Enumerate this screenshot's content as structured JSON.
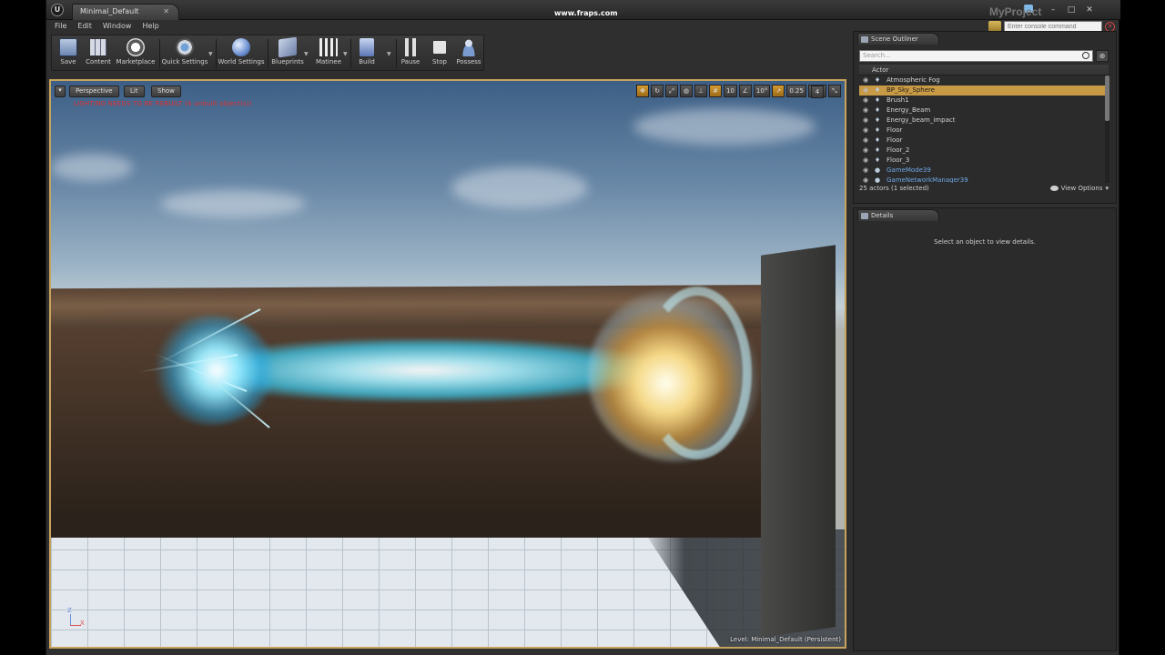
{
  "window": {
    "tab_title": "Minimal_Default",
    "overlay_text": "www.fraps.com",
    "project_name": "MyProject",
    "minimize": "–",
    "maximize": "□",
    "close": "✕"
  },
  "menu": [
    "File",
    "Edit",
    "Window",
    "Help"
  ],
  "console": {
    "placeholder": "Enter console command"
  },
  "toolbar": {
    "items": [
      {
        "label": "Save",
        "icon": "save-icon"
      },
      {
        "label": "Content",
        "icon": "content-browser-icon"
      },
      {
        "label": "Marketplace",
        "icon": "marketplace-icon"
      },
      {
        "label": "Quick Settings",
        "icon": "quick-settings-icon"
      },
      {
        "label": "World Settings",
        "icon": "world-settings-icon"
      },
      {
        "label": "Blueprints",
        "icon": "blueprints-icon"
      },
      {
        "label": "Matinee",
        "icon": "matinee-icon"
      },
      {
        "label": "Build",
        "icon": "build-icon"
      },
      {
        "label": "Pause",
        "icon": "pause-icon"
      },
      {
        "label": "Stop",
        "icon": "stop-icon"
      },
      {
        "label": "Possess",
        "icon": "possess-icon"
      }
    ]
  },
  "viewport": {
    "perspective": "Perspective",
    "lit": "Lit",
    "show": "Show",
    "warning": "LIGHTING NEEDS TO BE REBUILT (4 unbuilt object(s))",
    "grid_snap": "10",
    "rot_snap": "10°",
    "scale_snap": "0.25",
    "cam_speed": "4",
    "level_label": "Level:",
    "level_name": "Minimal_Default (Persistent)",
    "axis_z": "Z",
    "axis_x": "X"
  },
  "outliner": {
    "tab": "Scene Outliner",
    "search_placeholder": "Search...",
    "column": "Actor",
    "rows": [
      {
        "label": "Atmospheric Fog",
        "link": false
      },
      {
        "label": "BP_Sky_Sphere",
        "link": false,
        "selected": true
      },
      {
        "label": "Brush1",
        "link": false
      },
      {
        "label": "Energy_Beam",
        "link": false
      },
      {
        "label": "Energy_beam_impact",
        "link": false
      },
      {
        "label": "Floor",
        "link": false
      },
      {
        "label": "Floor",
        "link": false
      },
      {
        "label": "Floor_2",
        "link": false
      },
      {
        "label": "Floor_3",
        "link": false
      },
      {
        "label": "GameMode39",
        "link": true
      },
      {
        "label": "GameNetworkManager39",
        "link": true
      }
    ],
    "status": "25 actors (1 selected)",
    "view_options": "View Options"
  },
  "details": {
    "tab": "Details",
    "message": "Select an object to view details."
  },
  "colors": {
    "selection": "#c99a45",
    "viewport_border": "#c8a35b",
    "warning": "#e03030",
    "link": "#6fa8e8"
  }
}
